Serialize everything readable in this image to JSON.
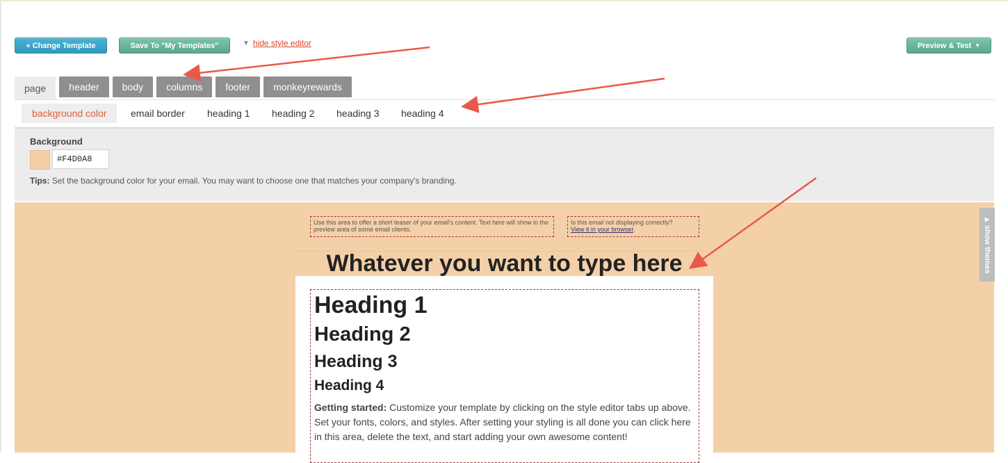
{
  "toolbar": {
    "change_template": "« Change Template",
    "save_template": "Save To \"My Templates\"",
    "hide_style_editor": "hide style editor",
    "preview_test": "Preview & Test"
  },
  "tabs": [
    "page",
    "header",
    "body",
    "columns",
    "footer",
    "monkeyrewards"
  ],
  "subtabs": [
    "background color",
    "email border",
    "heading 1",
    "heading 2",
    "heading 3",
    "heading 4"
  ],
  "settings": {
    "label": "Background",
    "color_value": "#F4D0A8",
    "tips_label": "Tips:",
    "tips_text": "Set the background color for your email. You may want to choose one that matches your company's branding."
  },
  "email": {
    "preheader_teaser": "Use this area to offer a short teaser of your email's content. Text here will show in the preview area of some email clients.",
    "preheader_question": "Is this email not displaying correctly?",
    "preheader_link": "View it in your browser",
    "header_text": "Whatever you want to type here",
    "heading1": "Heading 1",
    "heading2": "Heading 2",
    "heading3": "Heading 3",
    "heading4": "Heading 4",
    "intro_label": "Getting started:",
    "intro_text": "Customize your template by clicking on the style editor tabs up above. Set your fonts, colors, and styles. After setting your styling is all done you can click here in this area, delete the text, and start adding your own awesome content!"
  },
  "side": {
    "show_themes": "show themes"
  },
  "colors": {
    "canvas_bg": "#F4D0A8",
    "accent_red": "#e05a3a",
    "button_blue": "#2f9abc",
    "button_green": "#5aa98c",
    "annotation_arrow": "#e8594a"
  }
}
